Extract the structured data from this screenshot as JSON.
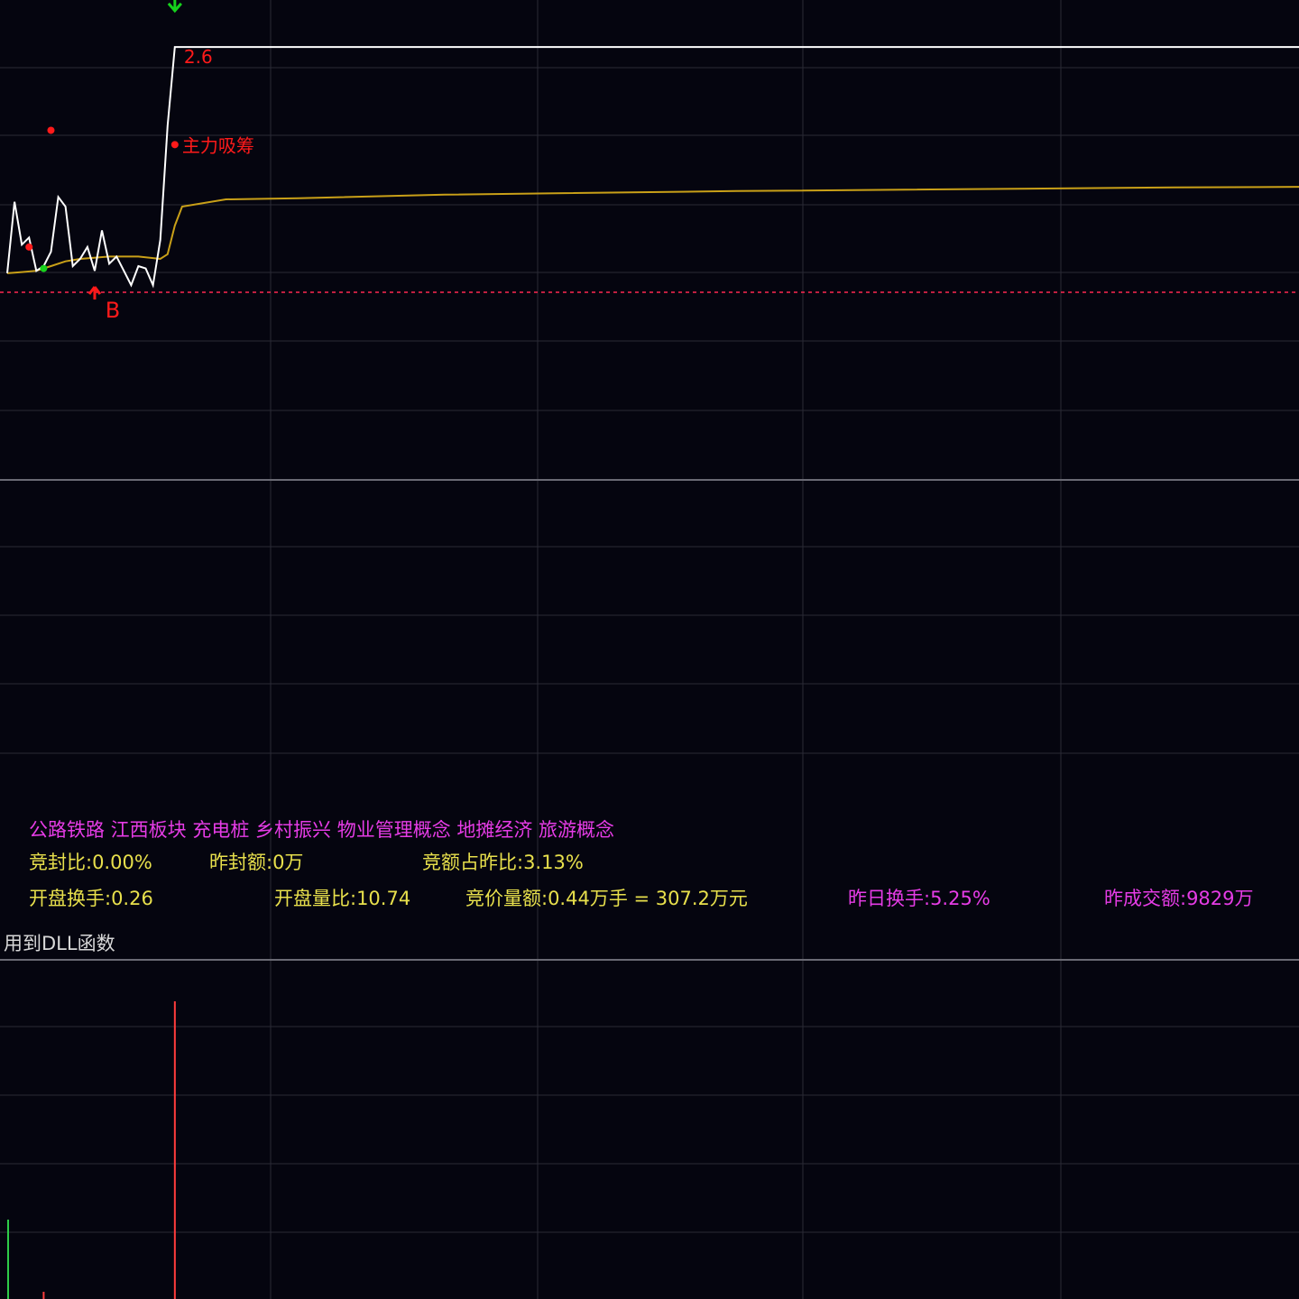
{
  "colors": {
    "background": "#05050f",
    "grid": "#2a2a36",
    "separator": "#6a6a74",
    "price_line": "#ffffff",
    "avg_line": "#c9a018",
    "ref_line": "#ff2850",
    "signal_red": "#ff1a1a",
    "signal_green": "#16d21c",
    "info_yellow": "#e8e04c",
    "info_magenta": "#e63ce6",
    "vol_red": "#ff3c3c",
    "vol_green": "#2ecc48"
  },
  "chart_data": {
    "type": "line",
    "grid": true,
    "series": [
      {
        "values": [
          [
            0,
            0.8
          ],
          [
            1,
            3.8
          ],
          [
            2,
            2.0
          ],
          [
            3,
            2.3
          ],
          [
            4,
            0.9
          ],
          [
            5,
            1.1
          ],
          [
            6,
            1.7
          ],
          [
            7,
            4.0
          ],
          [
            8,
            3.6
          ],
          [
            9,
            1.1
          ],
          [
            10,
            1.4
          ],
          [
            11,
            1.9
          ],
          [
            12,
            0.9
          ],
          [
            13,
            2.6
          ],
          [
            14,
            1.2
          ],
          [
            15,
            1.5
          ],
          [
            16,
            0.9
          ],
          [
            17,
            0.3
          ],
          [
            18,
            1.1
          ],
          [
            19,
            1.0
          ],
          [
            20,
            0.3
          ],
          [
            21,
            2.2
          ],
          [
            22,
            7.0
          ],
          [
            23,
            10.3
          ],
          [
            24,
            10.3
          ],
          [
            240,
            10.3
          ]
        ]
      },
      {
        "values": [
          [
            0,
            0.8
          ],
          [
            2,
            0.85
          ],
          [
            4,
            0.9
          ],
          [
            6,
            1.1
          ],
          [
            8,
            1.3
          ],
          [
            10,
            1.4
          ],
          [
            14,
            1.5
          ],
          [
            18,
            1.5
          ],
          [
            21,
            1.4
          ],
          [
            22,
            1.6
          ],
          [
            23,
            2.8
          ],
          [
            24,
            3.6
          ],
          [
            30,
            3.9
          ],
          [
            40,
            3.95
          ],
          [
            60,
            4.1
          ],
          [
            100,
            4.25
          ],
          [
            160,
            4.4
          ],
          [
            196,
            4.45
          ],
          [
            204,
            4.8
          ],
          [
            208,
            4.9
          ],
          [
            240,
            4.93
          ]
        ]
      }
    ],
    "reference_line": 0.0,
    "signals": [
      {
        "kind": "up-arrow",
        "label": "B",
        "x": 12,
        "y": 0.0
      },
      {
        "kind": "down-arrow",
        "label": "",
        "x": 23,
        "y": 12.2
      },
      {
        "kind": "dot",
        "label": "2.6",
        "x": 24,
        "y": 10.3
      },
      {
        "kind": "dot",
        "label": "主力吸筹",
        "x": 23,
        "y": 6.2
      },
      {
        "kind": "dot",
        "label": "",
        "x": 3,
        "y": 1.9
      },
      {
        "kind": "dot",
        "label": "",
        "x": 6,
        "y": 6.8
      },
      {
        "kind": "dot",
        "label": "",
        "x": 5,
        "y": 1.0
      }
    ],
    "volume": [
      {
        "x": 1,
        "v": 88,
        "dir": "down"
      },
      {
        "x": 5,
        "v": 8,
        "dir": "up"
      },
      {
        "x": 23,
        "v": 330,
        "dir": "up"
      }
    ]
  },
  "info": {
    "concepts": "公路铁路 江西板块 充电桩 乡村振兴 物业管理概念 地摊经济 旅游概念",
    "seal_ratio": "竞封比:0.00%",
    "prev_seal": "昨封额:0万",
    "bid_ratio": "竞额占昨比:3.13%",
    "open_turnover": "开盘换手:0.26",
    "open_vol_ratio": "开盘量比:10.74",
    "bid_volume": "竞价量额:0.44万手 = 307.2万元",
    "prev_turnover": "昨日换手:5.25%",
    "prev_amount": "昨成交额:9829万"
  },
  "footer_label": "用到DLL函数"
}
